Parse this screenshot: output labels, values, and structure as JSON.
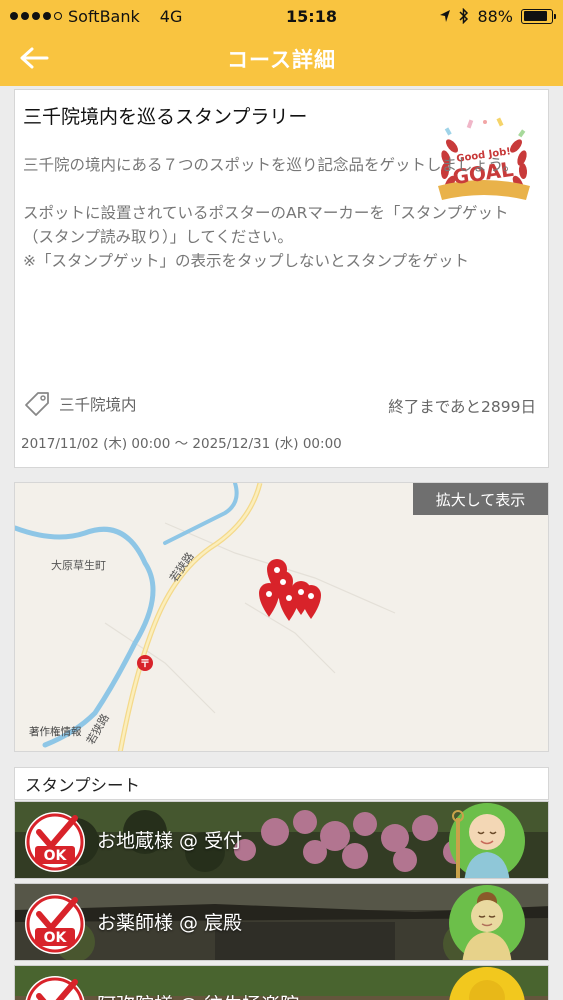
{
  "status_bar": {
    "carrier": "SoftBank",
    "network": "4G",
    "time": "15:18",
    "battery": "88%",
    "battery_level": 0.88
  },
  "nav": {
    "title": "コース詳細"
  },
  "course": {
    "title": "三千院境内を巡るスタンプラリー",
    "description": "三千院の境内にある７つのスポットを巡り記念品をゲットしましょう。\n\nスポットに設置されているポスターのARマーカーを「スタンプゲット（スタンプ読み取り）」してください。\n※「スタンプゲット」の表示をタップしないとスタンプをゲット",
    "place": "三千院境内",
    "remaining": "終了まであと2899日",
    "period": "2017/11/02 (木) 00:00 〜 2025/12/31 (水) 00:00",
    "badge": {
      "top_text": "Good Job!",
      "main_text": "GOAL"
    }
  },
  "map": {
    "expand_label": "拡大して表示",
    "town_label": "大原草生町",
    "road_label_1": "若狭路",
    "road_label_2": "若狭路",
    "attribution": "著作権情報"
  },
  "stamp_sheet": {
    "header": "スタンプシート",
    "ok_text": "OK",
    "items": [
      {
        "label": "お地蔵様 @ 受付"
      },
      {
        "label": "お薬師様 @ 宸殿"
      },
      {
        "label": "阿弥陀様 @ 往生極楽院"
      }
    ]
  },
  "colors": {
    "accent": "#f9c440",
    "stamp_red": "#d8232a"
  }
}
